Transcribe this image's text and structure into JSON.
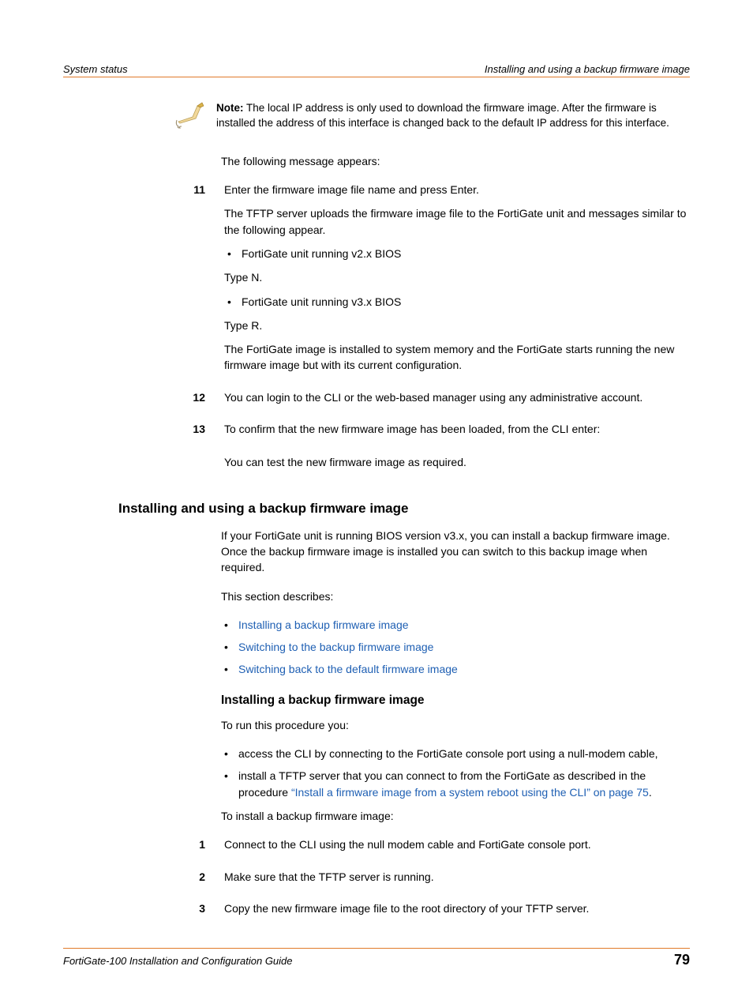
{
  "header": {
    "left": "System status",
    "right": "Installing and using a backup firmware image"
  },
  "note": {
    "label": "Note:",
    "body": " The local IP address is only used to download the firmware image. After the firmware is installed the address of this interface is changed back to the default IP address for this interface."
  },
  "intro_after_note": "The following message appears:",
  "step11": {
    "num": "11",
    "p1": "Enter the firmware image file name and press Enter.",
    "p2": "The TFTP server uploads the firmware image file to the FortiGate unit and messages similar to the following appear.",
    "b1": "FortiGate unit running v2.x BIOS",
    "t1": "Type N.",
    "b2": "FortiGate unit running v3.x BIOS",
    "t2": "Type R.",
    "p3": "The FortiGate image is installed to system memory and the FortiGate starts running the new firmware image but with its current configuration."
  },
  "step12": {
    "num": "12",
    "p1": "You can login to the CLI or the web-based manager using any administrative account."
  },
  "step13": {
    "num": "13",
    "p1": "To confirm that the new firmware image has been loaded, from the CLI enter:",
    "p2": "You can test the new firmware image as required."
  },
  "sectionA": {
    "title": "Installing and using a backup firmware image",
    "p1": "If your FortiGate unit is running BIOS version v3.x, you can install a backup firmware image. Once the backup firmware image is installed you can switch to this backup image when required.",
    "p2": "This section describes:",
    "links": {
      "l1": "Installing a backup firmware image",
      "l2": "Switching to the backup firmware image",
      "l3": "Switching back to the default firmware image"
    }
  },
  "sectionB": {
    "title": "Installing a backup firmware image",
    "p1": "To run this procedure you:",
    "b1": "access the CLI by connecting to the FortiGate console port using a null-modem cable,",
    "b2a": "install a TFTP server that you can connect to from the FortiGate as described in the procedure ",
    "b2link": "“Install a firmware image from a system reboot using the CLI” on page 75",
    "b2b": ".",
    "p2": "To install a backup firmware image:"
  },
  "stepsB": {
    "s1": {
      "num": "1",
      "text": "Connect to the CLI using the null modem cable and FortiGate console port."
    },
    "s2": {
      "num": "2",
      "text": "Make sure that the TFTP server is running."
    },
    "s3": {
      "num": "3",
      "text": "Copy the new firmware image file to the root directory of your TFTP server."
    }
  },
  "footer": {
    "left": "FortiGate-100 Installation and Configuration Guide",
    "page": "79"
  }
}
